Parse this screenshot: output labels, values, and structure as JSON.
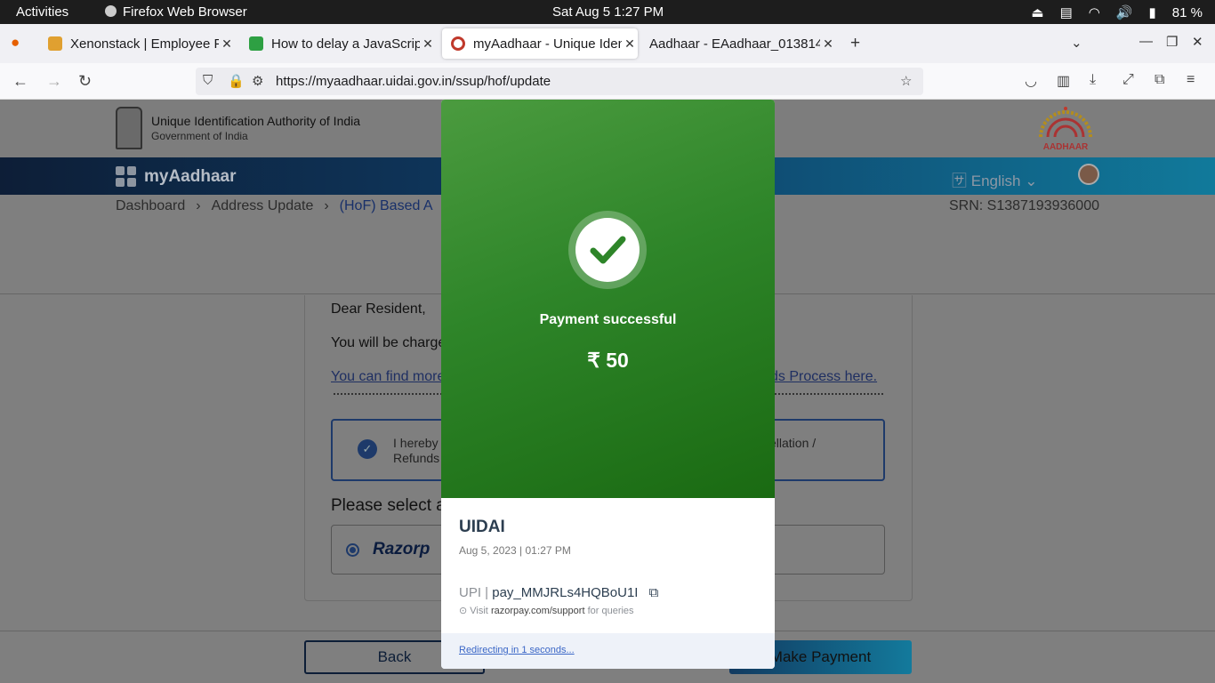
{
  "system": {
    "activities": "Activities",
    "app_name": "Firefox Web Browser",
    "clock": "Sat Aug 5   1:27 PM",
    "battery": "81 %"
  },
  "tabs": [
    {
      "title": "Xenonstack | Employee F",
      "favicon_color": "#e0a030"
    },
    {
      "title": "How to delay a JavaScrip",
      "favicon_color": "#2ea043"
    },
    {
      "title": "myAadhaar - Unique Iden",
      "favicon_color": "#c0392b"
    },
    {
      "title": "Aadhaar - EAadhaar_013814",
      "favicon_color": "#f0f0f4"
    }
  ],
  "browser": {
    "url": "https://myaadhaar.uidai.gov.in/ssup/hof/update"
  },
  "site": {
    "org_name": "Unique Identification Authority of India",
    "org_sub": "Government of India",
    "logo_text": "AADHAAR",
    "brand": "myAadhaar",
    "language": "English",
    "breadcrumb": [
      "Dashboard",
      "Address Update",
      "(HoF) Based A"
    ],
    "srn": "SRN: S1387193936000"
  },
  "content": {
    "greeting": "Dear Resident,",
    "charge_text": "You will be charge",
    "link_left": "You can find more",
    "link_right": "ds Process here.",
    "consent_left_1": "I hereby c",
    "consent_left_2": "Refunds",
    "consent_right": "cellation /",
    "select_heading": "Please select a",
    "gateway": "Razorp",
    "back": "Back",
    "make_payment": "Make Payment"
  },
  "payment_modal": {
    "status": "Payment successful",
    "amount": "₹ 50",
    "merchant": "UIDAI",
    "datetime": "Aug 5, 2023 | 01:27 PM",
    "method": "UPI",
    "payment_id": "pay_MMJRLs4HQBoU1I",
    "support_prefix": "Visit",
    "support_link": "razorpay.com/support",
    "support_suffix": "for queries",
    "redirect": "Redirecting in 1 seconds..."
  },
  "colors": {
    "success_green": "#2e8529",
    "brand_blue": "#0e3d66",
    "tab_bar": "#f0f0f4"
  }
}
